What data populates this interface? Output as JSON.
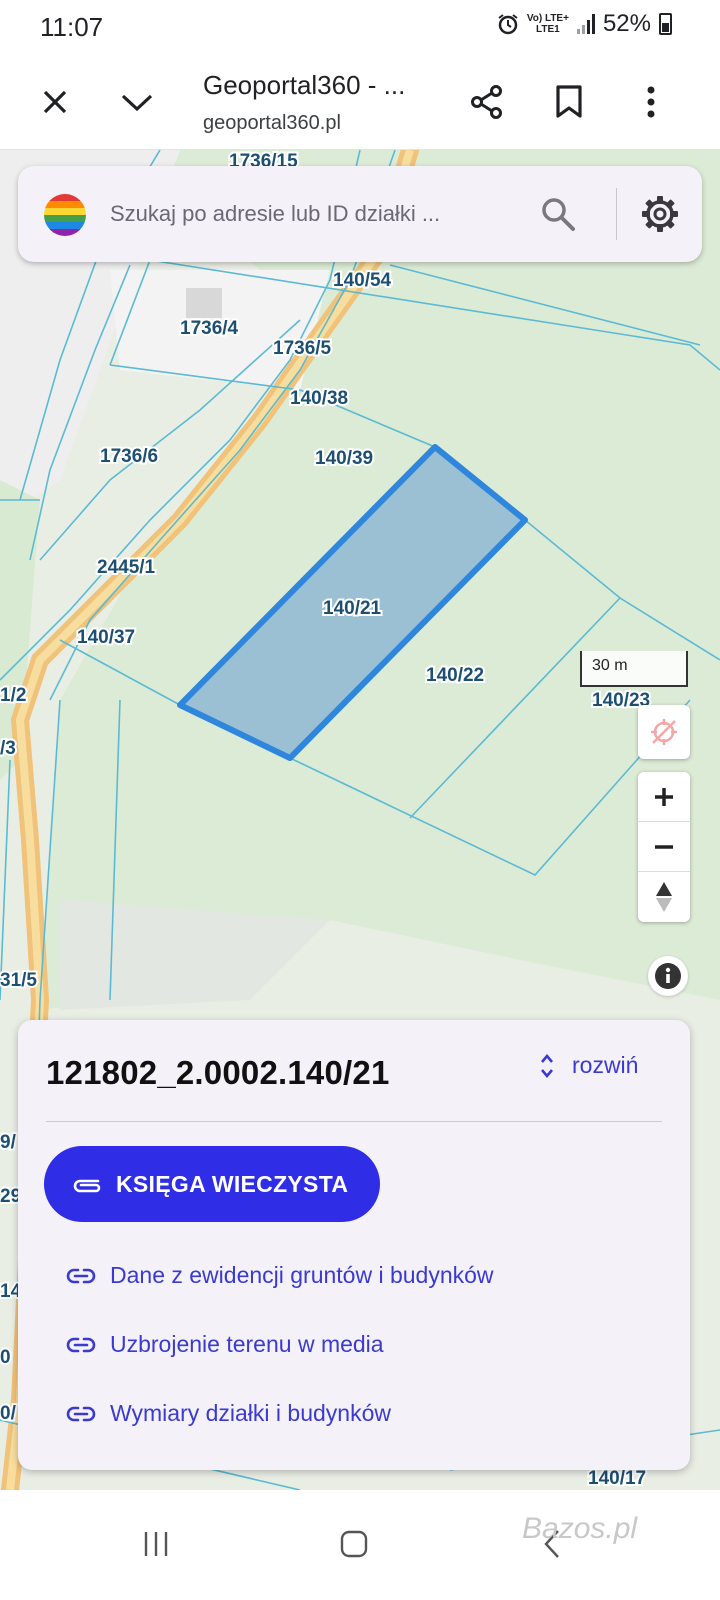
{
  "status_bar": {
    "time": "11:07",
    "network_line1": "Vo) LTE+",
    "network_line2": "LTE1",
    "battery": "52%"
  },
  "browser": {
    "title": "Geoportal360 - ...",
    "url": "geoportal360.pl",
    "icons": [
      "close-icon",
      "chevron-down-icon",
      "share-icon",
      "bookmark-icon",
      "more-vert-icon"
    ]
  },
  "search": {
    "placeholder": "Szukaj po adresie lub ID działki ..."
  },
  "map": {
    "scale_label": "30 m",
    "parcel_labels": [
      "1736/15",
      "140/54",
      "1736/4",
      "1736/5",
      "140/38",
      "1736/6",
      "140/39",
      "2445/1",
      "140/21",
      "140/37",
      "140/22",
      "140/23",
      "1/2",
      "/3",
      "31/5",
      "9/",
      "29",
      "14",
      "0",
      "0/",
      "140/17"
    ],
    "selected_parcel": "140/21",
    "controls": [
      "location-off-icon",
      "zoom-in-icon",
      "zoom-out-icon",
      "compass-icon",
      "info-icon"
    ],
    "colors": {
      "parcel_line": "#5bbad3",
      "selected_outline": "#2f86dd",
      "selected_fill": "#8fb8d2",
      "road": "#f2c77a"
    }
  },
  "panel": {
    "parcel_id": "121802_2.0002.140/21",
    "expand_label": "rozwiń",
    "primary_button": "KSIĘGA WIECZYSTA",
    "links": [
      "Dane z ewidencji gruntów i budynków",
      "Uzbrojenie terenu w media",
      "Wymiary działki i budynków"
    ],
    "accent": "#2f2de6"
  },
  "navbar": {
    "watermark": "Bazos.pl"
  }
}
